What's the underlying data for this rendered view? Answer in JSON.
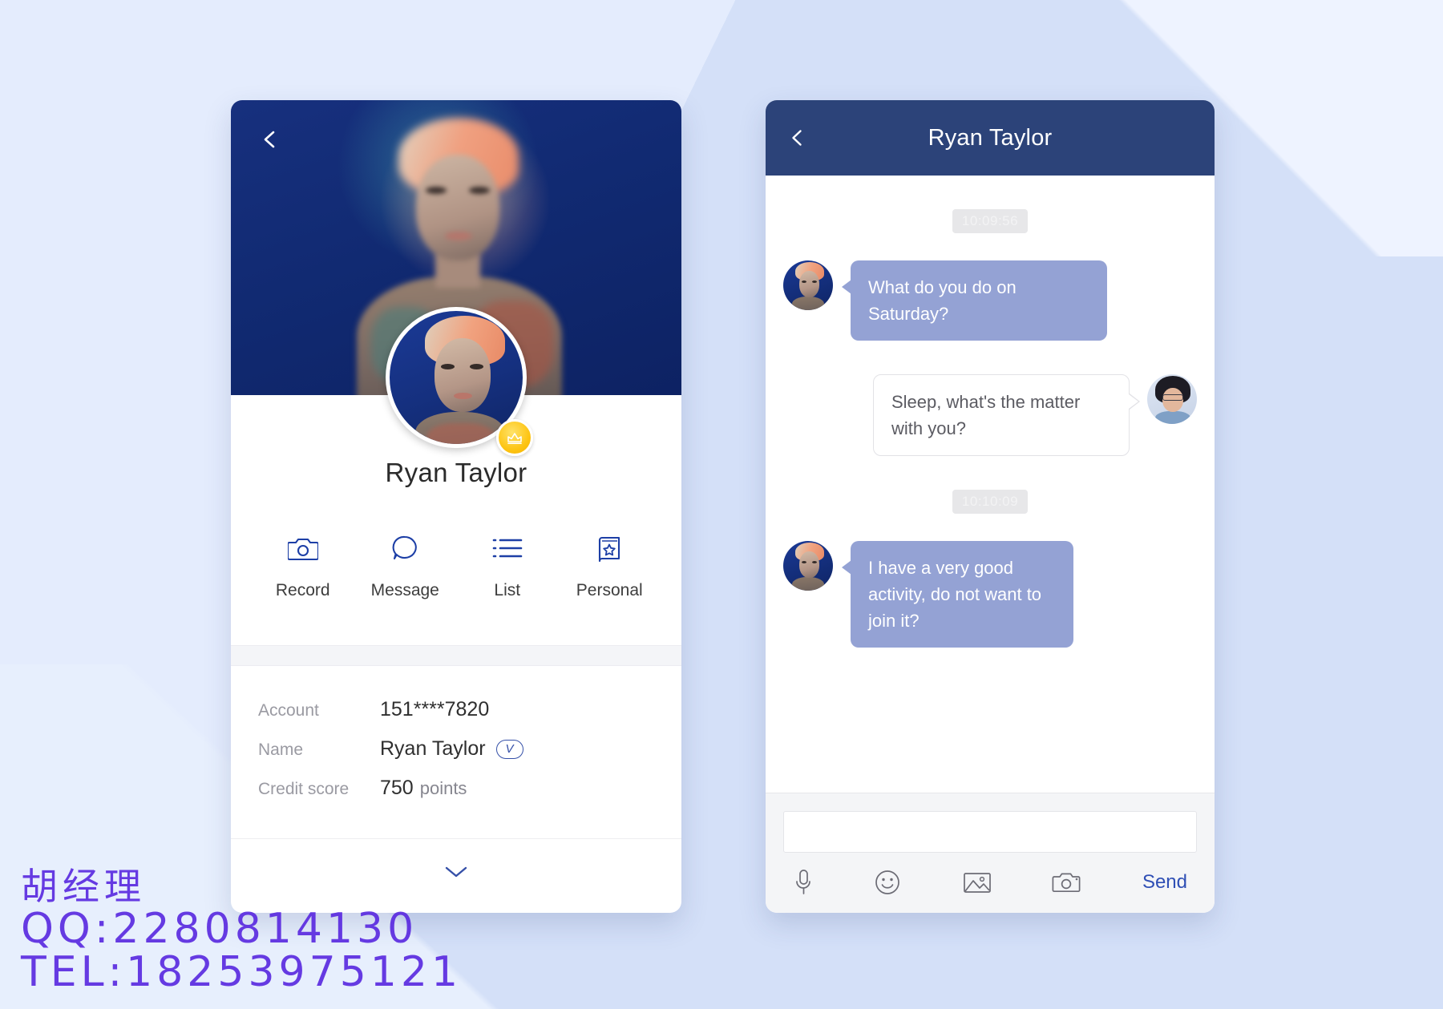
{
  "profile": {
    "back_icon": "chevron-left-icon",
    "name": "Ryan Taylor",
    "badge_icon": "crown-icon",
    "actions": [
      {
        "icon": "camera-icon",
        "label": "Record"
      },
      {
        "icon": "message-icon",
        "label": "Message"
      },
      {
        "icon": "list-icon",
        "label": "List"
      },
      {
        "icon": "bookmark-star-icon",
        "label": "Personal"
      }
    ],
    "info": [
      {
        "label": "Account",
        "value": "151****7820",
        "badge": ""
      },
      {
        "label": "Name",
        "value": "Ryan Taylor",
        "badge": "V"
      },
      {
        "label": "Credit score",
        "value": "750",
        "suffix": "points"
      }
    ],
    "expand_icon": "chevron-down-icon"
  },
  "chat": {
    "back_icon": "chevron-left-icon",
    "title": "Ryan Taylor",
    "messages": [
      {
        "type": "timestamp",
        "text": "10:09:56"
      },
      {
        "type": "in",
        "text": "What do you do on Saturday?"
      },
      {
        "type": "out",
        "text": "Sleep, what's the matter with you?"
      },
      {
        "type": "timestamp",
        "text": "10:10:09"
      },
      {
        "type": "in",
        "text": "I have a very good activity, do not want to join it?"
      }
    ],
    "input_value": "",
    "input_placeholder": "",
    "toolbar": [
      {
        "icon": "microphone-icon"
      },
      {
        "icon": "smiley-icon"
      },
      {
        "icon": "image-icon"
      },
      {
        "icon": "camera-icon"
      }
    ],
    "send_label": "Send"
  },
  "watermark": {
    "line1": "胡经理",
    "line2": "QQ:2280814130",
    "line3": "TEL:18253975121"
  },
  "colors": {
    "header_blue": "#2c4379",
    "accent_blue": "#2f4fb5",
    "bubble_in": "#94a2d4",
    "badge_yellow": "#fdc412",
    "page_bg": "#dce6fa"
  }
}
